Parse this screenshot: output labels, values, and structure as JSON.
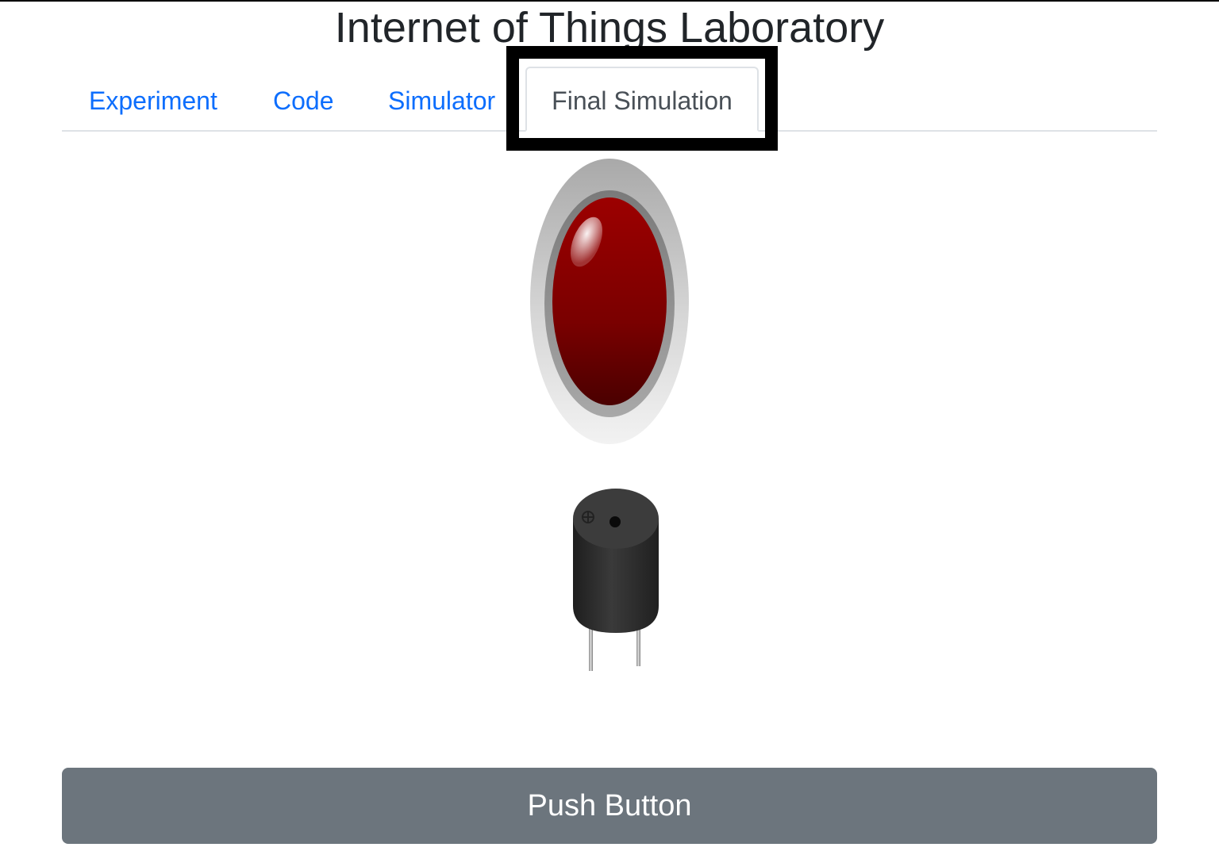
{
  "header": {
    "title": "Internet of Things Laboratory"
  },
  "tabs": [
    {
      "label": "Experiment",
      "active": false
    },
    {
      "label": "Code",
      "active": false
    },
    {
      "label": "Simulator",
      "active": false
    },
    {
      "label": "Final Simulation",
      "active": true
    }
  ],
  "simulation": {
    "led": {
      "color": "#990000",
      "state": "off"
    },
    "buzzer": {
      "color": "#2b2b2b"
    }
  },
  "actions": {
    "push_button_label": "Push Button"
  },
  "colors": {
    "link": "#0d6efd",
    "button_bg": "#6c757d",
    "title": "#212529"
  }
}
